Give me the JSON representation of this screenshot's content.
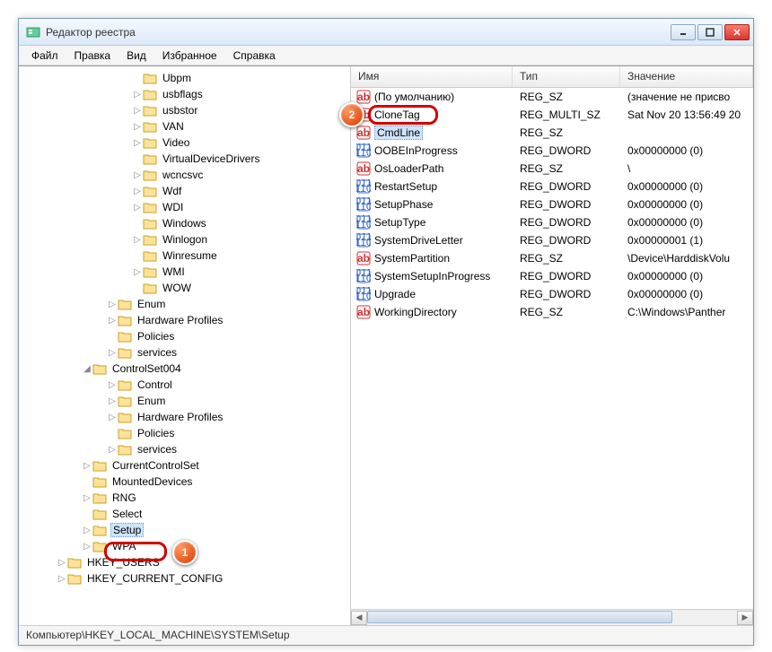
{
  "window": {
    "title": "Редактор реестра"
  },
  "menu": {
    "file": "Файл",
    "edit": "Правка",
    "view": "Вид",
    "favorites": "Избранное",
    "help": "Справка"
  },
  "tree": [
    {
      "indent": 9,
      "label": "Ubpm",
      "exp": ""
    },
    {
      "indent": 9,
      "label": "usbflags",
      "exp": "▷"
    },
    {
      "indent": 9,
      "label": "usbstor",
      "exp": "▷"
    },
    {
      "indent": 9,
      "label": "VAN",
      "exp": "▷"
    },
    {
      "indent": 9,
      "label": "Video",
      "exp": "▷"
    },
    {
      "indent": 9,
      "label": "VirtualDeviceDrivers",
      "exp": ""
    },
    {
      "indent": 9,
      "label": "wcncsvc",
      "exp": "▷"
    },
    {
      "indent": 9,
      "label": "Wdf",
      "exp": "▷"
    },
    {
      "indent": 9,
      "label": "WDI",
      "exp": "▷"
    },
    {
      "indent": 9,
      "label": "Windows",
      "exp": ""
    },
    {
      "indent": 9,
      "label": "Winlogon",
      "exp": "▷"
    },
    {
      "indent": 9,
      "label": "Winresume",
      "exp": ""
    },
    {
      "indent": 9,
      "label": "WMI",
      "exp": "▷"
    },
    {
      "indent": 9,
      "label": "WOW",
      "exp": ""
    },
    {
      "indent": 7,
      "label": "Enum",
      "exp": "▷"
    },
    {
      "indent": 7,
      "label": "Hardware Profiles",
      "exp": "▷"
    },
    {
      "indent": 7,
      "label": "Policies",
      "exp": ""
    },
    {
      "indent": 7,
      "label": "services",
      "exp": "▷"
    },
    {
      "indent": 5,
      "label": "ControlSet004",
      "exp": "◢"
    },
    {
      "indent": 7,
      "label": "Control",
      "exp": "▷"
    },
    {
      "indent": 7,
      "label": "Enum",
      "exp": "▷"
    },
    {
      "indent": 7,
      "label": "Hardware Profiles",
      "exp": "▷"
    },
    {
      "indent": 7,
      "label": "Policies",
      "exp": ""
    },
    {
      "indent": 7,
      "label": "services",
      "exp": "▷"
    },
    {
      "indent": 5,
      "label": "CurrentControlSet",
      "exp": "▷"
    },
    {
      "indent": 5,
      "label": "MountedDevices",
      "exp": ""
    },
    {
      "indent": 5,
      "label": "RNG",
      "exp": "▷"
    },
    {
      "indent": 5,
      "label": "Select",
      "exp": ""
    },
    {
      "indent": 5,
      "label": "Setup",
      "exp": "▷",
      "selected": true
    },
    {
      "indent": 5,
      "label": "WPA",
      "exp": "▷"
    },
    {
      "indent": 3,
      "label": "HKEY_USERS",
      "exp": "▷"
    },
    {
      "indent": 3,
      "label": "HKEY_CURRENT_CONFIG",
      "exp": "▷"
    }
  ],
  "cols": {
    "name": "Имя",
    "type": "Тип",
    "value": "Значение"
  },
  "values": [
    {
      "icon": "str",
      "name": "(По умолчанию)",
      "type": "REG_SZ",
      "value": "(значение не присво"
    },
    {
      "icon": "str",
      "name": "CloneTag",
      "type": "REG_MULTI_SZ",
      "value": "Sat Nov 20 13:56:49 20"
    },
    {
      "icon": "str",
      "name": "CmdLine",
      "type": "REG_SZ",
      "value": "",
      "selected": true
    },
    {
      "icon": "bin",
      "name": "OOBEInProgress",
      "type": "REG_DWORD",
      "value": "0x00000000 (0)"
    },
    {
      "icon": "str",
      "name": "OsLoaderPath",
      "type": "REG_SZ",
      "value": "\\"
    },
    {
      "icon": "bin",
      "name": "RestartSetup",
      "type": "REG_DWORD",
      "value": "0x00000000 (0)"
    },
    {
      "icon": "bin",
      "name": "SetupPhase",
      "type": "REG_DWORD",
      "value": "0x00000000 (0)"
    },
    {
      "icon": "bin",
      "name": "SetupType",
      "type": "REG_DWORD",
      "value": "0x00000000 (0)"
    },
    {
      "icon": "bin",
      "name": "SystemDriveLetter",
      "type": "REG_DWORD",
      "value": "0x00000001 (1)"
    },
    {
      "icon": "str",
      "name": "SystemPartition",
      "type": "REG_SZ",
      "value": "\\Device\\HarddiskVolu"
    },
    {
      "icon": "bin",
      "name": "SystemSetupInProgress",
      "type": "REG_DWORD",
      "value": "0x00000000 (0)"
    },
    {
      "icon": "bin",
      "name": "Upgrade",
      "type": "REG_DWORD",
      "value": "0x00000000 (0)"
    },
    {
      "icon": "str",
      "name": "WorkingDirectory",
      "type": "REG_SZ",
      "value": "C:\\Windows\\Panther"
    }
  ],
  "status": "Компьютер\\HKEY_LOCAL_MACHINE\\SYSTEM\\Setup",
  "badges": {
    "b1": "1",
    "b2": "2"
  }
}
